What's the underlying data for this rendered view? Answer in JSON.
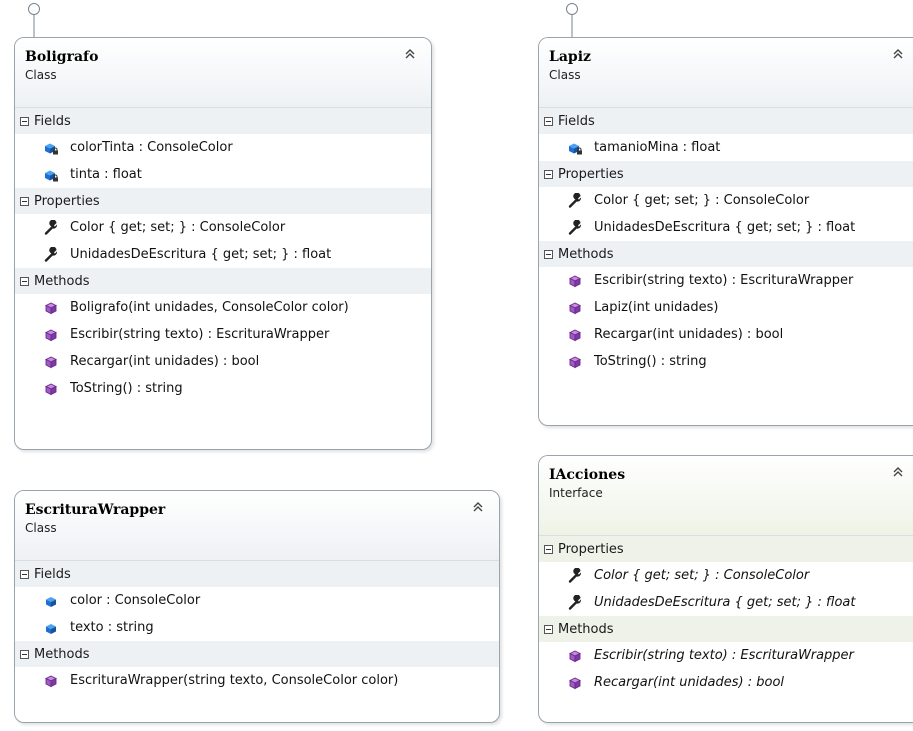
{
  "colors": {
    "border": "#9aa4ad",
    "section_bg": "#eef1f4",
    "interface_bg": "#eef2e8",
    "field_icon": "#1e6fd0",
    "method_icon": "#8a3aa8",
    "property_icon": "#222222"
  },
  "classes": [
    {
      "name": "Boligrafo",
      "kind": "Class",
      "implements_interface_lollipop": true,
      "sections": [
        {
          "label": "Fields",
          "items": [
            {
              "text": "colorTinta : ConsoleColor",
              "icon": "private-field-icon"
            },
            {
              "text": "tinta : float",
              "icon": "private-field-icon"
            }
          ]
        },
        {
          "label": "Properties",
          "items": [
            {
              "text": "Color { get; set; } : ConsoleColor",
              "icon": "property-wrench-icon"
            },
            {
              "text": "UnidadesDeEscritura { get; set; } : float",
              "icon": "property-wrench-icon"
            }
          ]
        },
        {
          "label": "Methods",
          "items": [
            {
              "text": "Boligrafo(int unidades, ConsoleColor color)",
              "icon": "method-cube-icon"
            },
            {
              "text": "Escribir(string texto) : EscrituraWrapper",
              "icon": "method-cube-icon"
            },
            {
              "text": "Recargar(int unidades) : bool",
              "icon": "method-cube-icon"
            },
            {
              "text": "ToString() : string",
              "icon": "method-cube-icon"
            }
          ]
        }
      ]
    },
    {
      "name": "Lapiz",
      "kind": "Class",
      "implements_interface_lollipop": true,
      "sections": [
        {
          "label": "Fields",
          "items": [
            {
              "text": "tamanioMina : float",
              "icon": "private-field-icon"
            }
          ]
        },
        {
          "label": "Properties",
          "items": [
            {
              "text": "Color { get; set; } : ConsoleColor",
              "icon": "property-wrench-icon"
            },
            {
              "text": "UnidadesDeEscritura { get; set; } : float",
              "icon": "property-wrench-icon"
            }
          ]
        },
        {
          "label": "Methods",
          "items": [
            {
              "text": "Escribir(string texto) : EscrituraWrapper",
              "icon": "method-cube-icon"
            },
            {
              "text": "Lapiz(int unidades)",
              "icon": "method-cube-icon"
            },
            {
              "text": "Recargar(int unidades) : bool",
              "icon": "method-cube-icon"
            },
            {
              "text": "ToString() : string",
              "icon": "method-cube-icon"
            }
          ]
        }
      ]
    },
    {
      "name": "EscrituraWrapper",
      "kind": "Class",
      "implements_interface_lollipop": false,
      "sections": [
        {
          "label": "Fields",
          "items": [
            {
              "text": "color : ConsoleColor",
              "icon": "public-field-icon"
            },
            {
              "text": "texto : string",
              "icon": "public-field-icon"
            }
          ]
        },
        {
          "label": "Methods",
          "items": [
            {
              "text": "EscrituraWrapper(string texto, ConsoleColor color)",
              "icon": "method-cube-icon"
            }
          ]
        }
      ]
    },
    {
      "name": "IAcciones",
      "kind": "Interface",
      "implements_interface_lollipop": false,
      "sections": [
        {
          "label": "Properties",
          "items": [
            {
              "text": "Color { get; set; } : ConsoleColor",
              "icon": "property-wrench-icon"
            },
            {
              "text": "UnidadesDeEscritura { get; set; } : float",
              "icon": "property-wrench-icon"
            }
          ]
        },
        {
          "label": "Methods",
          "items": [
            {
              "text": "Escribir(string texto) : EscrituraWrapper",
              "icon": "method-cube-icon"
            },
            {
              "text": "Recargar(int unidades) : bool",
              "icon": "method-cube-icon"
            }
          ]
        }
      ]
    }
  ]
}
